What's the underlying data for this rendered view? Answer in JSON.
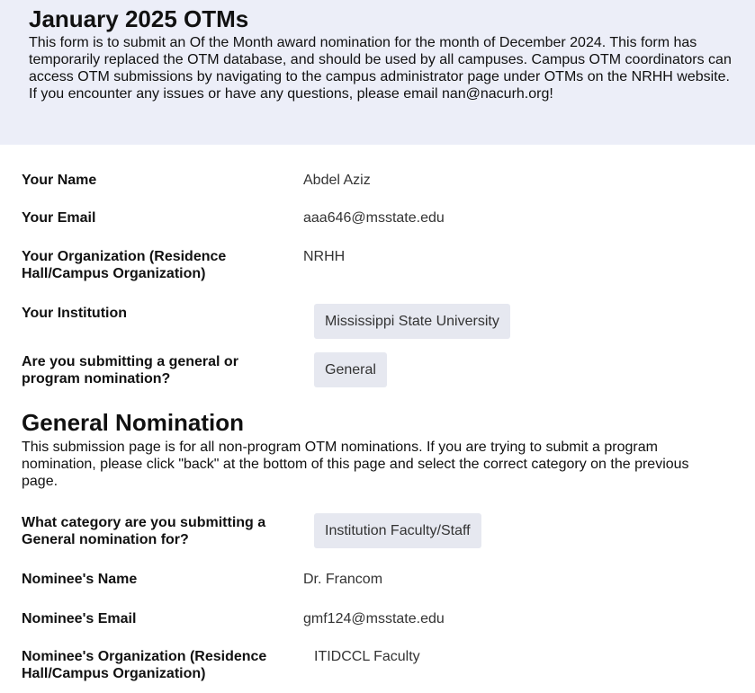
{
  "header": {
    "title": "January 2025 OTMs",
    "description": "This form is to submit an Of the Month award nomination for the month of December 2024. This form has temporarily replaced the OTM database, and should be used by all campuses. Campus OTM coordinators can access OTM submissions by navigating to the campus administrator page under OTMs on the NRHH website. If you encounter any issues or have any questions, please email nan@nacurh.org!"
  },
  "fields": {
    "your_name": {
      "label": "Your Name",
      "value": "Abdel Aziz"
    },
    "your_email": {
      "label": "Your Email",
      "value": "aaa646@msstate.edu"
    },
    "your_org": {
      "label": "Your Organization (Residence Hall/Campus Organization)",
      "value": "NRHH"
    },
    "your_institution": {
      "label": "Your Institution",
      "value": "Mississippi State University"
    },
    "nomination_type": {
      "label": "Are you submitting a general or program nomination?",
      "value": "General"
    }
  },
  "general_section": {
    "title": "General Nomination",
    "description": "This submission page is for all non-program OTM nominations. If you are trying to submit a program nomination, please click \"back\" at the bottom of this page and select the correct category on the previous page.",
    "fields": {
      "category": {
        "label": "What category are you submitting a General nomination for?",
        "value": "Institution Faculty/Staff"
      },
      "nominee_name": {
        "label": "Nominee's Name",
        "value": "Dr. Francom"
      },
      "nominee_email": {
        "label": "Nominee's Email",
        "value": "gmf124@msstate.edu"
      },
      "nominee_org": {
        "label": "Nominee's Organization (Residence Hall/Campus Organization)",
        "value": "ITIDCCL Faculty"
      }
    }
  }
}
